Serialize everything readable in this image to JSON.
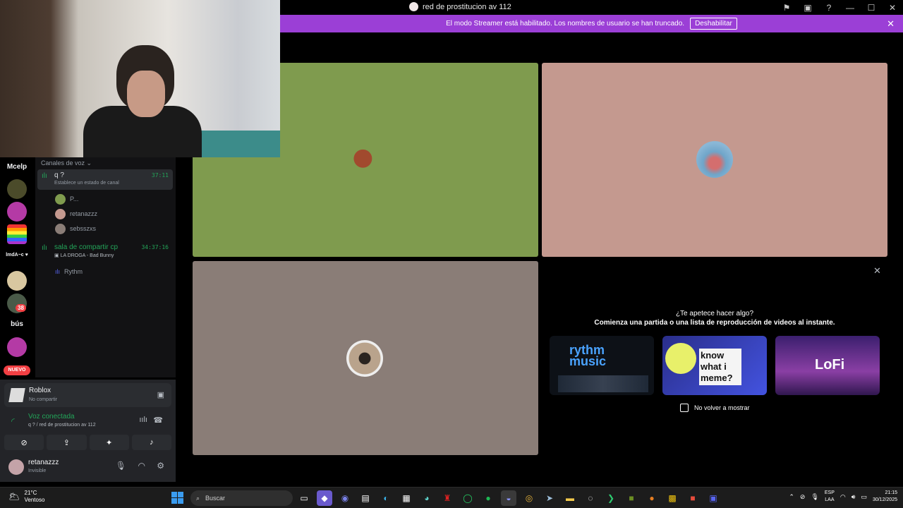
{
  "window": {
    "title": "red de prostitucion av 112"
  },
  "banner": {
    "message": "El modo Streamer está habilitado. Los nombres de usuario se han truncado.",
    "button": "Deshabilitar"
  },
  "rail": {
    "items": [
      "Mcelp",
      "bús"
    ],
    "badge": "38",
    "nuevo": "NUEVO"
  },
  "sidebar": {
    "category": "Canales de voz",
    "channels": [
      {
        "name": "q ?",
        "status": "Establece un estado de canal",
        "time": "37:11",
        "users": [
          "P...",
          "retanazzz",
          "sebsszxs"
        ]
      },
      {
        "name": "sala de compartir cp",
        "time": "34:37:16",
        "activity": "LA DROGA - Bad Bunny",
        "users": [
          "Rythm"
        ]
      }
    ]
  },
  "panel": {
    "activity_title": "Roblox",
    "activity_sub": "No compartir",
    "voice_title": "Voz conectada",
    "voice_sub": "q ? / red de prostitucion av 112",
    "user_name": "retanazzz",
    "user_status": "Invisible"
  },
  "suggestion": {
    "question": "¿Te apetece hacer algo?",
    "sub": "Comienza una partida o una lista de reproducción de videos al instante.",
    "cards": [
      "rythm music",
      "know what i meme?",
      "LoFi"
    ],
    "checkbox": "No volver a mostrar"
  },
  "taskbar": {
    "temp": "21°C",
    "weather": "Ventoso",
    "search": "Buscar",
    "lang1": "ESP",
    "lang2": "LAA",
    "time": "21:15",
    "date": "30/12/2025"
  },
  "colors": {
    "banner": "#9b3fd6",
    "tile_green": "#7f9b4e",
    "tile_pink": "#c4998f",
    "tile_taupe": "#8a7d77",
    "voice_green": "#23a559"
  }
}
